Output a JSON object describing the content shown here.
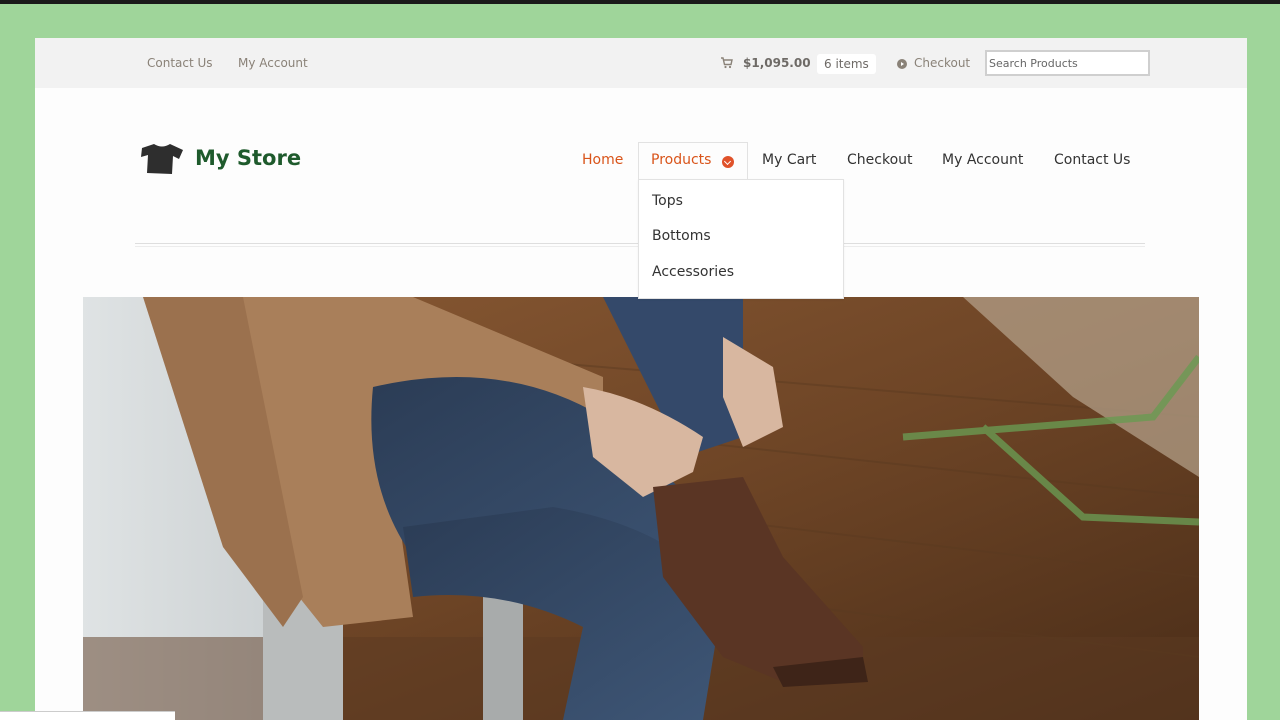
{
  "topbar": {
    "contact_label": "Contact Us",
    "account_label": "My Account",
    "cart_total": "$1,095.00",
    "cart_items": "6 items",
    "checkout_label": "Checkout",
    "search_placeholder": "Search Products"
  },
  "header": {
    "logo_text": "My Store",
    "nav": {
      "home": "Home",
      "products": "Products",
      "cart": "My Cart",
      "checkout": "Checkout",
      "account": "My Account",
      "contact": "Contact Us"
    },
    "products_menu": [
      "Tops",
      "Bottoms",
      "Accessories"
    ]
  },
  "icons": {
    "cart": "cart-icon",
    "checkout": "arrow-circle-icon",
    "logo": "tshirt-icon",
    "dropdown": "chevron-down-icon"
  },
  "colors": {
    "accent": "#d9541a",
    "logo_green": "#1e5a2c",
    "background": "#9fd59a"
  }
}
